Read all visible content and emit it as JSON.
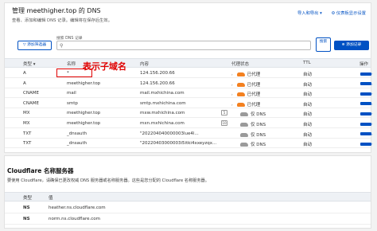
{
  "header": {
    "title_prefix": "管理",
    "domain": "meethigher.top",
    "title_suffix": "的 DNS",
    "subtitle": "查看、添加和编辑 DNS 记录。编辑将在保存后生效。",
    "import_export": "导入和导出 ▾",
    "dashboard_settings": "⚙ 仪表板显示设置"
  },
  "search": {
    "label": "搜索 DNS 记录",
    "placeholder": "",
    "add_filter": "▽ 添加筛选器",
    "search_button": "搜索",
    "add_record": "⊕ 添加记录"
  },
  "table": {
    "headers": [
      "类型 ▾",
      "名称",
      "内容",
      "代理状态",
      "TTL",
      "操作"
    ],
    "rows": [
      {
        "type": "A",
        "name": "*",
        "content": "124.156.200.66",
        "proxy": "已代理",
        "proxied": true,
        "ttl": "自动"
      },
      {
        "type": "A",
        "name": "meethigher.top",
        "content": "124.156.200.66",
        "proxy": "已代理",
        "proxied": true,
        "ttl": "自动"
      },
      {
        "type": "CNAME",
        "name": "mail",
        "content": "mail.mxhichina.com",
        "proxy": "已代理",
        "proxied": true,
        "ttl": "自动"
      },
      {
        "type": "CNAME",
        "name": "smtp",
        "content": "smtp.mxhichina.com",
        "proxy": "已代理",
        "proxied": true,
        "ttl": "自动"
      },
      {
        "type": "MX",
        "name": "meethigher.top",
        "content": "mxw.mxhichina.com",
        "priority": "5",
        "proxy": "仅 DNS",
        "proxied": false,
        "ttl": "自动"
      },
      {
        "type": "MX",
        "name": "meethigher.top",
        "content": "mxn.mxhichina.com",
        "priority": "10",
        "proxy": "仅 DNS",
        "proxied": false,
        "ttl": "自动"
      },
      {
        "type": "TXT",
        "name": "_dnsauth",
        "content": "\"202204040000003lue4l...",
        "proxy": "仅 DNS",
        "proxied": false,
        "ttl": "自动"
      },
      {
        "type": "TXT",
        "name": "_dnsauth",
        "content": "\"20220403000003i5itki4xxeyzqx...",
        "proxy": "仅 DNS",
        "proxied": false,
        "ttl": "自动"
      }
    ]
  },
  "annotation": "表示子域名",
  "nameservers": {
    "title": "Cloudflare 名称服务器",
    "subtitle": "要使用 Cloudflare，请确保已更改权威 DNS 服务器或名称服务器。这些是您分配的 Cloudflare 名称服务器。",
    "headers": [
      "类型",
      "值"
    ],
    "rows": [
      {
        "type": "NS",
        "value": "heather.ns.cloudflare.com"
      },
      {
        "type": "NS",
        "value": "norm.ns.cloudflare.com"
      }
    ]
  },
  "colors": {
    "accent": "#0051c3",
    "proxy_orange": "#f38020",
    "annotation_red": "#e00000"
  }
}
